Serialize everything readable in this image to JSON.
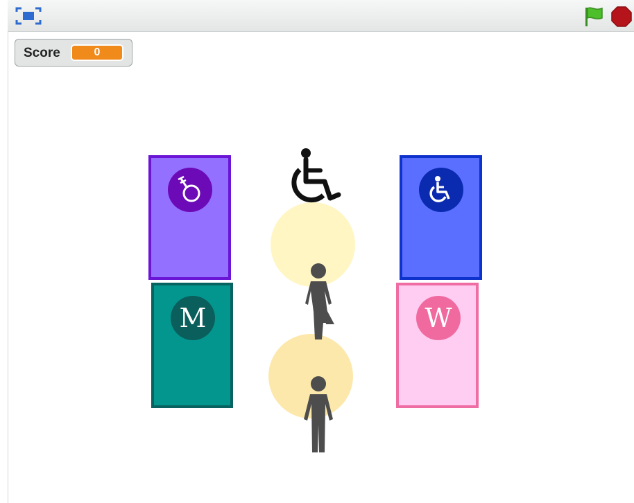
{
  "toolbar": {
    "fullscreen_icon": "fullscreen-icon",
    "green_flag_icon": "green-flag-icon",
    "stop_icon": "stop-sign-icon",
    "flag_color": "#4cbf2a",
    "stop_color": "#b5141a"
  },
  "score": {
    "label": "Score",
    "value": "0",
    "value_color": "#f08a1b"
  },
  "doors": {
    "genderqueer": {
      "icon": "genderqueer-symbol-icon",
      "fill": "#9370ff",
      "border": "#6b16d6",
      "badge": "#6c0ab8"
    },
    "accessible": {
      "icon": "wheelchair-icon",
      "fill": "#5a6fff",
      "border": "#0e32cc",
      "badge": "#0a2ab0"
    },
    "men": {
      "letter": "M",
      "fill": "#03968f",
      "border": "#08625f",
      "badge": "#0a5e5b"
    },
    "women": {
      "letter": "W",
      "fill": "#ffccf2",
      "border": "#ee6da3",
      "badge": "#f06aa0"
    }
  },
  "sprites": {
    "wheelchair": "wheelchair-icon",
    "woman_figure": "woman-figure-icon",
    "man_figure": "man-figure-icon",
    "spot_top_color": "#fff6c4",
    "spot_bottom_color": "#fde8ac"
  }
}
